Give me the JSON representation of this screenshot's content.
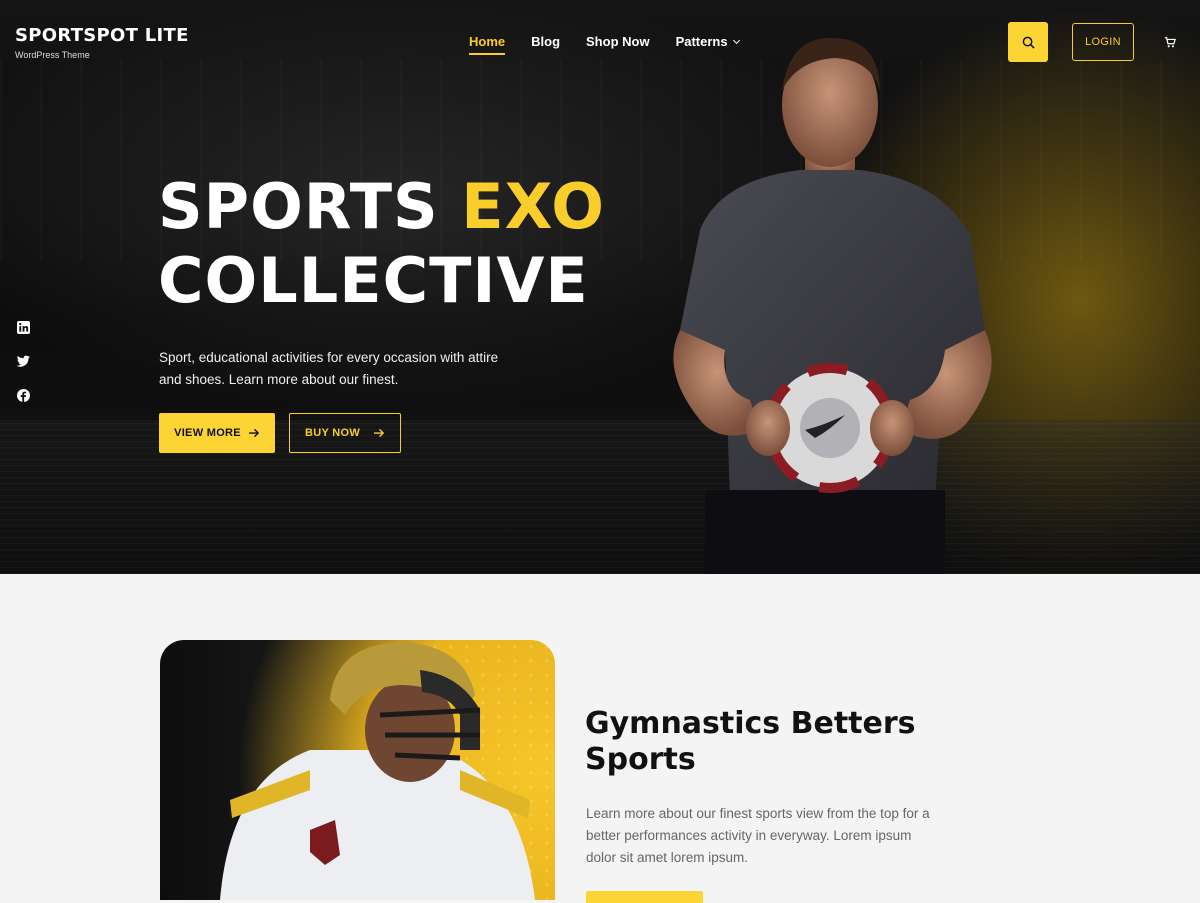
{
  "brand": {
    "title": "SPORTSPOT LITE",
    "tagline": "WordPress Theme"
  },
  "nav": {
    "items": [
      {
        "label": "Home",
        "active": true
      },
      {
        "label": "Blog",
        "active": false
      },
      {
        "label": "Shop Now",
        "active": false
      },
      {
        "label": "Patterns",
        "active": false,
        "has_dropdown": true
      }
    ]
  },
  "header": {
    "search_icon": "search-icon",
    "login_label": "LOGIN",
    "cart_icon": "cart-icon"
  },
  "social": {
    "icons": [
      "linkedin-icon",
      "twitter-icon",
      "facebook-icon"
    ]
  },
  "hero": {
    "title_part1": "SPORTS",
    "title_accent": "EXO",
    "title_line2": "COLLECTIVE",
    "description": "Sport, educational activities for every occasion with attire and shoes. Learn more about our finest.",
    "primary_button": "VIEW MORE",
    "secondary_button": "BUY NOW"
  },
  "feature": {
    "title": "Gymnastics Betters Sports",
    "description": "Learn more about our finest sports view from the top for a better performances activity in everyway. Lorem ipsum dolor sit amet lorem ipsum."
  },
  "colors": {
    "accent": "#fcd535",
    "hero_bg": "#111111",
    "section_bg": "#f4f4f4"
  }
}
